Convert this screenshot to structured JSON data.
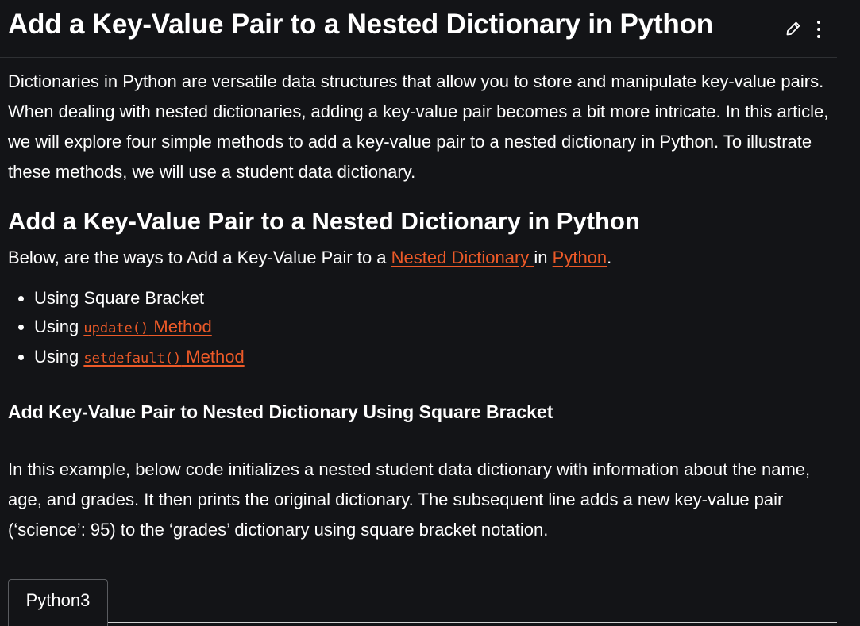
{
  "header": {
    "title": "Add a Key-Value Pair to a Nested Dictionary in Python",
    "edit_icon": "pencil-icon",
    "menu_icon": "kebab-menu-icon"
  },
  "intro": {
    "text": "Dictionaries in Python are versatile data structures that allow you to store and manipulate key-value pairs. When dealing with nested dictionaries, adding a key-value pair becomes a bit more intricate. In this article, we will explore four simple methods to add a key-value pair to a nested dictionary in Python. To illustrate these methods, we will use a student data dictionary."
  },
  "section": {
    "heading": "Add a Key-Value Pair to a Nested Dictionary in Python",
    "lead_prefix": "Below, are the ways to Add a Key-Value Pair to a ",
    "link_nested": "Nested Dictionary ",
    "lead_middle": "in ",
    "link_python": "Python",
    "lead_suffix": ".",
    "methods": [
      {
        "prefix": "Using ",
        "label": "Square Bracket"
      },
      {
        "prefix": "Using ",
        "code": "update()",
        "link_text": " Method"
      },
      {
        "prefix": "Using ",
        "code": "setdefault()",
        "link_text": " Method"
      }
    ]
  },
  "example": {
    "heading": "Add Key-Value Pair to Nested Dictionary Using Square Bracket",
    "text": "In this example, below code initializes a nested student data dictionary with information about the name, age, and grades. It then prints the original dictionary. The subsequent line adds a new key-value pair (‘science’: 95) to the ‘grades’ dictionary using square bracket notation."
  },
  "code_tabs": [
    {
      "label": "Python3"
    }
  ],
  "colors": {
    "background": "#131417",
    "text": "#ffffff",
    "link": "#ed5a28",
    "divider": "#2e3033"
  }
}
